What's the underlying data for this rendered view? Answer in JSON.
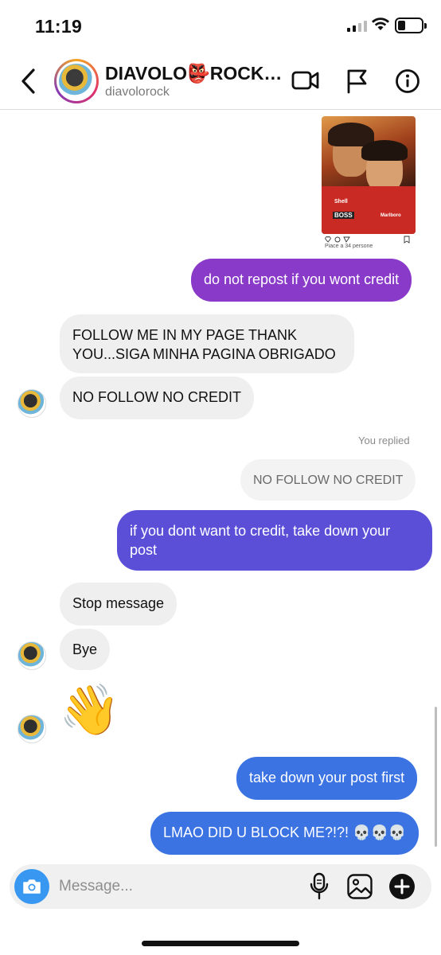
{
  "status_bar": {
    "time": "11:19"
  },
  "header": {
    "contact_name": "DIAVOLO👺ROCK…",
    "contact_handle": "diavolorock",
    "icons": [
      "back-chevron-icon",
      "video-call-icon",
      "flag-icon",
      "info-icon"
    ]
  },
  "shared_post": {
    "likes": "Piace a 34 persone",
    "brand_left": "Shell",
    "brand_right": "Marlboro",
    "brand_chest": "BOSS"
  },
  "messages": {
    "sent_repost": "do not repost if you wont credit",
    "recv_follow": "FOLLOW ME IN MY PAGE THANK YOU...SIGA MINHA PAGINA OBRIGADO",
    "recv_nocredit": "NO FOLLOW NO CREDIT",
    "you_replied": "You replied",
    "quoted": "NO FOLLOW NO CREDIT",
    "sent_takedown": "if you dont want to credit, take down your post",
    "recv_stop": "Stop message",
    "recv_bye": "Bye",
    "recv_wave": "👋",
    "sent_first": "take down your post first",
    "sent_block": "LMAO DID U BLOCK ME?!?! 💀💀💀"
  },
  "composer": {
    "placeholder": "Message..."
  },
  "colors": {
    "sent_purple": "#8a3ac9",
    "sent_indigo": "#5b4fd8",
    "sent_blue": "#3b73e3",
    "received_bg": "#efefef",
    "camera_blue": "#3897f0"
  }
}
